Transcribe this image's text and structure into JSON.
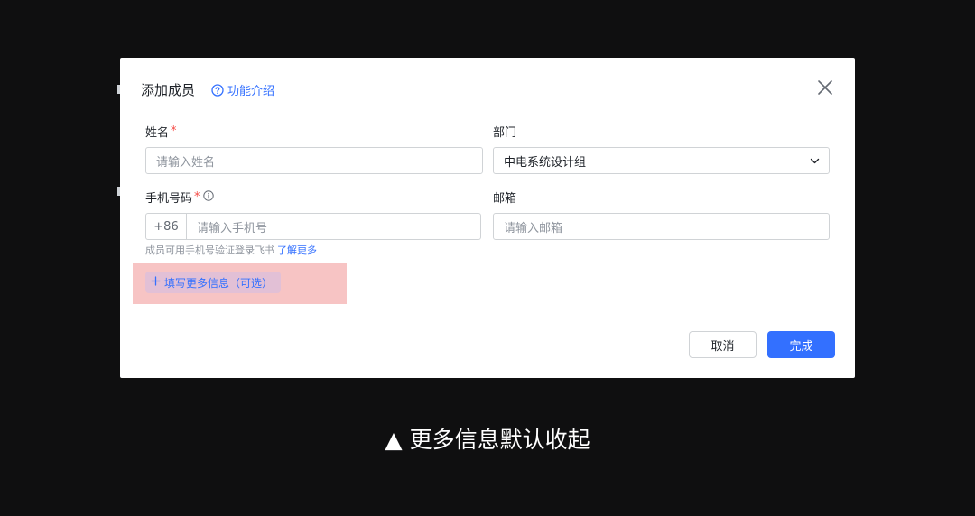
{
  "dialog": {
    "title": "添加成员",
    "help_link": "功能介绍",
    "fields": {
      "name": {
        "label": "姓名",
        "required_mark": "*",
        "placeholder": "请输入姓名"
      },
      "department": {
        "label": "部门",
        "value": "中电系统设计组"
      },
      "phone": {
        "label": "手机号码",
        "required_mark": "*",
        "prefix": "+86",
        "placeholder": "请输入手机号"
      },
      "email": {
        "label": "邮箱",
        "placeholder": "请输入邮箱"
      }
    },
    "hint": {
      "text": "成员可用手机号验证登录飞书",
      "link": "了解更多"
    },
    "more_info_button": "填写更多信息（可选）",
    "buttons": {
      "cancel": "取消",
      "confirm": "完成"
    }
  },
  "caption": "▲ 更多信息默认收起",
  "colors": {
    "accent": "#3370ff",
    "required": "#f54a45",
    "highlight": "#f7c4c4",
    "background": "#0f0f10"
  },
  "icons": [
    "question-circle-icon",
    "close-icon",
    "info-icon",
    "chevron-down-icon",
    "plus-icon"
  ]
}
